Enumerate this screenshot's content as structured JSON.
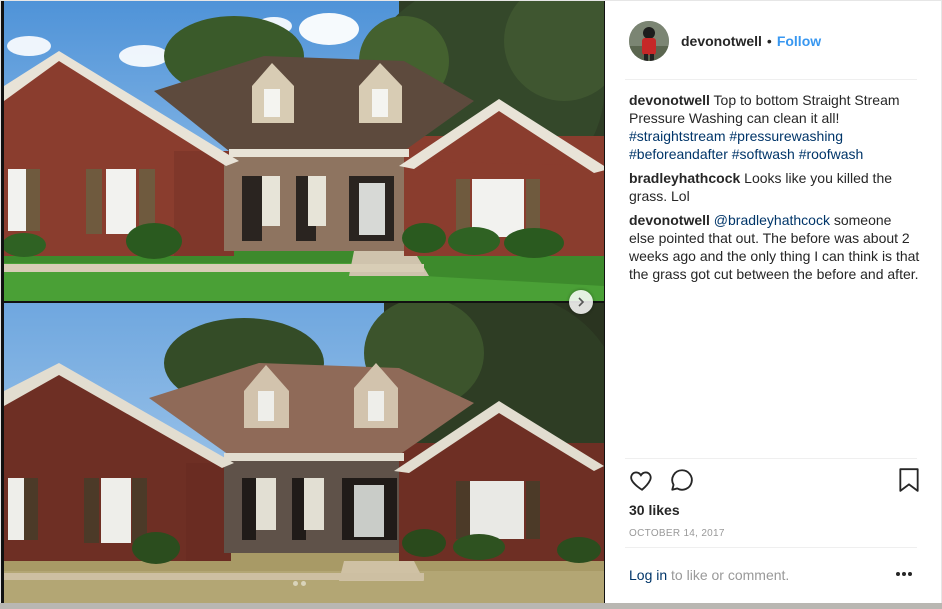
{
  "post": {
    "username": "devonotwell",
    "separator": "•",
    "follow_label": "Follow",
    "likes": "30 likes",
    "date": "OCTOBER 14, 2017"
  },
  "comments": [
    {
      "user": "devonotwell",
      "text": "Top to bottom Straight Stream Pressure Washing can clean it all!",
      "hashtags": [
        "#straightstream",
        "#pressurewashing",
        "#beforeandafter",
        "#softwash",
        "#roofwash"
      ]
    },
    {
      "user": "bradleyhathcock",
      "text": "Looks like you killed the grass. Lol"
    },
    {
      "user": "devonotwell",
      "mention": "@bradleyhathcock",
      "text": "someone else pointed that out. The before was about 2 weeks ago and the only thing I can think is that the grass got cut between the before and after."
    }
  ],
  "footer": {
    "login_label": "Log in",
    "login_suffix": "to like or comment."
  },
  "icons": {
    "like": "heart-icon",
    "comment": "comment-icon",
    "save": "bookmark-icon",
    "more": "more-options-icon",
    "next": "chevron-right-icon"
  },
  "colors": {
    "link_blue": "#3897f0",
    "hashtag": "#003569",
    "text": "#262626",
    "muted": "#999999"
  }
}
